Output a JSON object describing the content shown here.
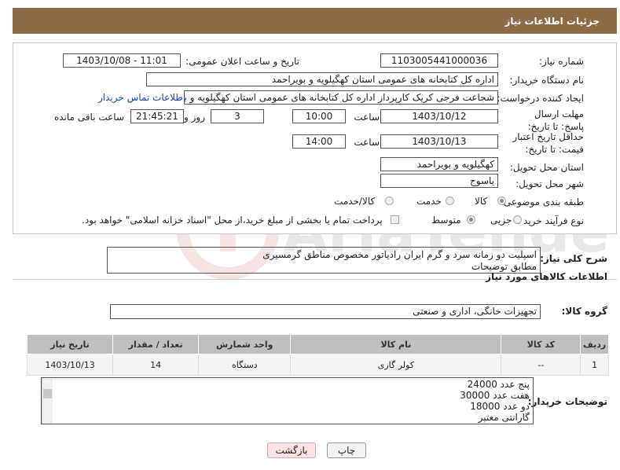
{
  "header": {
    "title": "جزئیات اطلاعات نیاز"
  },
  "fields": {
    "need_number_label": "شماره نیاز:",
    "need_number": "1103005441000036",
    "announce_label": "تاریخ و ساعت اعلان عمومی:",
    "announce_value": "1403/10/08 - 11:01",
    "buyer_label": "نام دستگاه خریدار:",
    "buyer_value": "اداره کل کتابخانه های عمومی استان کهگیلویه و بویراحمد",
    "creator_label": "ایجاد کننده درخواست:",
    "creator_value": "شجاعت فرجی کریک کارپرداز اداره کل کتابخانه های عمومی استان کهگیلویه و بویراحمد",
    "contact_link": "اطلاعات تماس خریدار",
    "deadline_label": "مهلت ارسال پاسخ: تا تاریخ:",
    "deadline_date": "1403/10/12",
    "time_label": "ساعت",
    "deadline_time": "10:00",
    "days_value": "3",
    "days_label": "روز و",
    "remaining_time": "21:45:21",
    "remaining_label": "ساعت باقی مانده",
    "validity_label": "حداقل تاریخ اعتبار قیمت: تا تاریخ:",
    "validity_date": "1403/10/13",
    "validity_time_label": "ساعت",
    "validity_time": "14:00",
    "province_label": "استان محل تحویل:",
    "province_value": "کهگیلویه و بویراحمد",
    "city_label": "شهر محل تحویل:",
    "city_value": "یاسوج",
    "category_label": "طبقه بندی موضوعی:",
    "category_options": [
      "کالا",
      "خدمت",
      "کالا/خدمت"
    ],
    "purchase_label": "نوع فرآیند خرید :",
    "purchase_options": [
      "جزیی",
      "متوسط"
    ],
    "payment_note": "پرداخت تمام یا بخشی از مبلغ خرید،از محل \"اسناد خزانه اسلامی\" خواهد بود."
  },
  "summary": {
    "label": "شرح کلی نیاز:",
    "lines": [
      "اسپلیت دو زمانه سرد و گرم ایران رادیاتور مخصوص مناطق گرمسیری",
      "مطابق توضیحات"
    ]
  },
  "goods_section": {
    "title": "اطلاعات کالاهای مورد نیاز",
    "group_label": "گروه کالا:",
    "group_value": "تجهیزات خانگی، اداری و صنعتی"
  },
  "table": {
    "headers": [
      "ردیف",
      "کد کالا",
      "نام کالا",
      "واحد شمارش",
      "تعداد / مقدار",
      "تاریخ نیاز"
    ],
    "rows": [
      [
        "1",
        "--",
        "کولر گازی",
        "دستگاه",
        "14",
        "1403/10/13"
      ]
    ]
  },
  "buyer_notes": {
    "label": "توضیحات خریدار:",
    "lines": [
      "پنج عدد 24000",
      "هفت عدد 30000",
      "دو عدد 18000",
      "گارانتی معتبر"
    ]
  },
  "buttons": {
    "print": "چاپ",
    "back": "بازگشت"
  },
  "watermark": {
    "text": "AriaTender.neT"
  },
  "colors": {
    "header_bg": "#8c6b46",
    "link": "#1a44b8",
    "back_btn": "#fbe3e3"
  }
}
